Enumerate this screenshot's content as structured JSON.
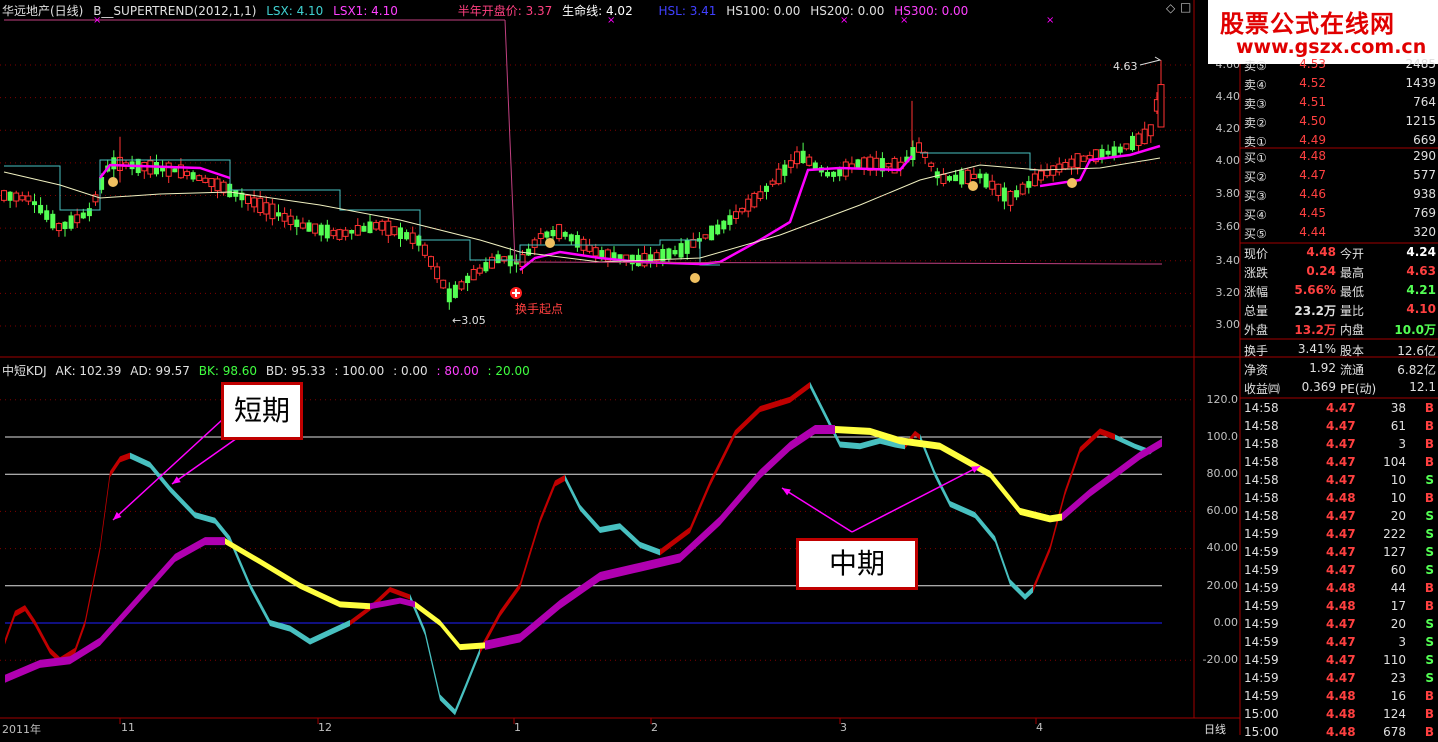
{
  "window_icons": {
    "diamond": "◇",
    "box": "□"
  },
  "main_header": {
    "stock": "华远地产(日线)",
    "indicator": "B__SUPERTREND(2012,1,1)",
    "lsx": "LSX: 4.10",
    "lsx1": "LSX1: 4.10",
    "half_year_open": "半年开盘价: 3.37",
    "life_line": "生命线: 4.02",
    "hsl": "HSL: 3.41",
    "hs100": "HS100: 0.00",
    "hs200": "HS200: 0.00",
    "hs300": "HS300: 0.00"
  },
  "kdj_header": {
    "name": "中短KDJ",
    "ak": "AK: 102.39",
    "ad": "AD: 99.57",
    "bk": "BK: 98.60",
    "bd": "BD: 95.33",
    "v1": ": 100.00",
    "v2": ": 0.00",
    "v3": ": 80.00",
    "v4": ": 20.00"
  },
  "price_axis": [
    "4.60",
    "4.40",
    "4.20",
    "4.00",
    "3.80",
    "3.60",
    "3.40",
    "3.20",
    "3.00"
  ],
  "kdj_axis": [
    "120.0",
    "100.0",
    "80.00",
    "60.00",
    "40.00",
    "20.00",
    "0.00",
    "-20.00"
  ],
  "x_axis": [
    "2011年",
    "11",
    "12",
    "1",
    "2",
    "3",
    "4"
  ],
  "x_axis_right": "日线",
  "annotations": {
    "high": "4.63",
    "low": "3.05",
    "start": "换手起点",
    "short": "短期",
    "mid": "中期"
  },
  "logo": {
    "line1": "股票公式在线网",
    "line2": "www.gszx.com.cn"
  },
  "colors": {
    "up": "#ff3232",
    "down": "#54ff54",
    "magenta": "#ff00ff",
    "cyan": "#48c0c0",
    "yellow": "#ffff40",
    "dark_red": "#b00000",
    "purple": "#b000b0",
    "pink_line": "#c04080"
  },
  "order_book": {
    "sell": [
      {
        "label": "卖⑤",
        "price": "4.53",
        "vol": "2485"
      },
      {
        "label": "卖④",
        "price": "4.52",
        "vol": "1439"
      },
      {
        "label": "卖③",
        "price": "4.51",
        "vol": "764"
      },
      {
        "label": "卖②",
        "price": "4.50",
        "vol": "1215"
      },
      {
        "label": "卖①",
        "price": "4.49",
        "vol": "669"
      }
    ],
    "buy": [
      {
        "label": "买①",
        "price": "4.48",
        "vol": "290"
      },
      {
        "label": "买②",
        "price": "4.47",
        "vol": "577"
      },
      {
        "label": "买③",
        "price": "4.46",
        "vol": "938"
      },
      {
        "label": "买④",
        "price": "4.45",
        "vol": "769"
      },
      {
        "label": "买⑤",
        "price": "4.44",
        "vol": "320"
      }
    ]
  },
  "quote": [
    {
      "l1": "现价",
      "v1": "4.48",
      "l2": "今开",
      "v2": "4.24",
      "c1": "#ff4040",
      "c2": "#ffffff"
    },
    {
      "l1": "涨跌",
      "v1": "0.24",
      "l2": "最高",
      "v2": "4.63",
      "c1": "#ff4040",
      "c2": "#ff4040"
    },
    {
      "l1": "涨幅",
      "v1": "5.66%",
      "l2": "最低",
      "v2": "4.21",
      "c1": "#ff4040",
      "c2": "#54ff54"
    },
    {
      "l1": "总量",
      "v1": "23.2万",
      "l2": "量比",
      "v2": "4.10",
      "c1": "#e0e0e0",
      "c2": "#ff4040"
    },
    {
      "l1": "外盘",
      "v1": "13.2万",
      "l2": "内盘",
      "v2": "10.0万",
      "c1": "#ff4040",
      "c2": "#54ff54"
    }
  ],
  "fundamentals": [
    {
      "l1": "换手",
      "v1": "3.41%",
      "l2": "股本",
      "v2": "12.6亿"
    },
    {
      "l1": "净资",
      "v1": "1.92",
      "l2": "流通",
      "v2": "6.82亿"
    },
    {
      "l1": "收益㈣",
      "v1": "0.369",
      "l2": "PE(动)",
      "v2": "12.1"
    }
  ],
  "ticks": [
    {
      "t": "14:58",
      "p": "4.47",
      "v": "38",
      "s": "B"
    },
    {
      "t": "14:58",
      "p": "4.47",
      "v": "61",
      "s": "B"
    },
    {
      "t": "14:58",
      "p": "4.47",
      "v": "3",
      "s": "B"
    },
    {
      "t": "14:58",
      "p": "4.47",
      "v": "104",
      "s": "B"
    },
    {
      "t": "14:58",
      "p": "4.47",
      "v": "10",
      "s": "S"
    },
    {
      "t": "14:58",
      "p": "4.48",
      "v": "10",
      "s": "B"
    },
    {
      "t": "14:58",
      "p": "4.47",
      "v": "20",
      "s": "S"
    },
    {
      "t": "14:59",
      "p": "4.47",
      "v": "222",
      "s": "S"
    },
    {
      "t": "14:59",
      "p": "4.47",
      "v": "127",
      "s": "S"
    },
    {
      "t": "14:59",
      "p": "4.47",
      "v": "60",
      "s": "S"
    },
    {
      "t": "14:59",
      "p": "4.48",
      "v": "44",
      "s": "B"
    },
    {
      "t": "14:59",
      "p": "4.48",
      "v": "17",
      "s": "B"
    },
    {
      "t": "14:59",
      "p": "4.47",
      "v": "20",
      "s": "S"
    },
    {
      "t": "14:59",
      "p": "4.47",
      "v": "3",
      "s": "S"
    },
    {
      "t": "14:59",
      "p": "4.47",
      "v": "110",
      "s": "S"
    },
    {
      "t": "14:59",
      "p": "4.47",
      "v": "23",
      "s": "S"
    },
    {
      "t": "14:59",
      "p": "4.48",
      "v": "16",
      "s": "B"
    },
    {
      "t": "15:00",
      "p": "4.48",
      "v": "124",
      "s": "B"
    },
    {
      "t": "15:00",
      "p": "4.48",
      "v": "678",
      "s": "B"
    }
  ]
}
